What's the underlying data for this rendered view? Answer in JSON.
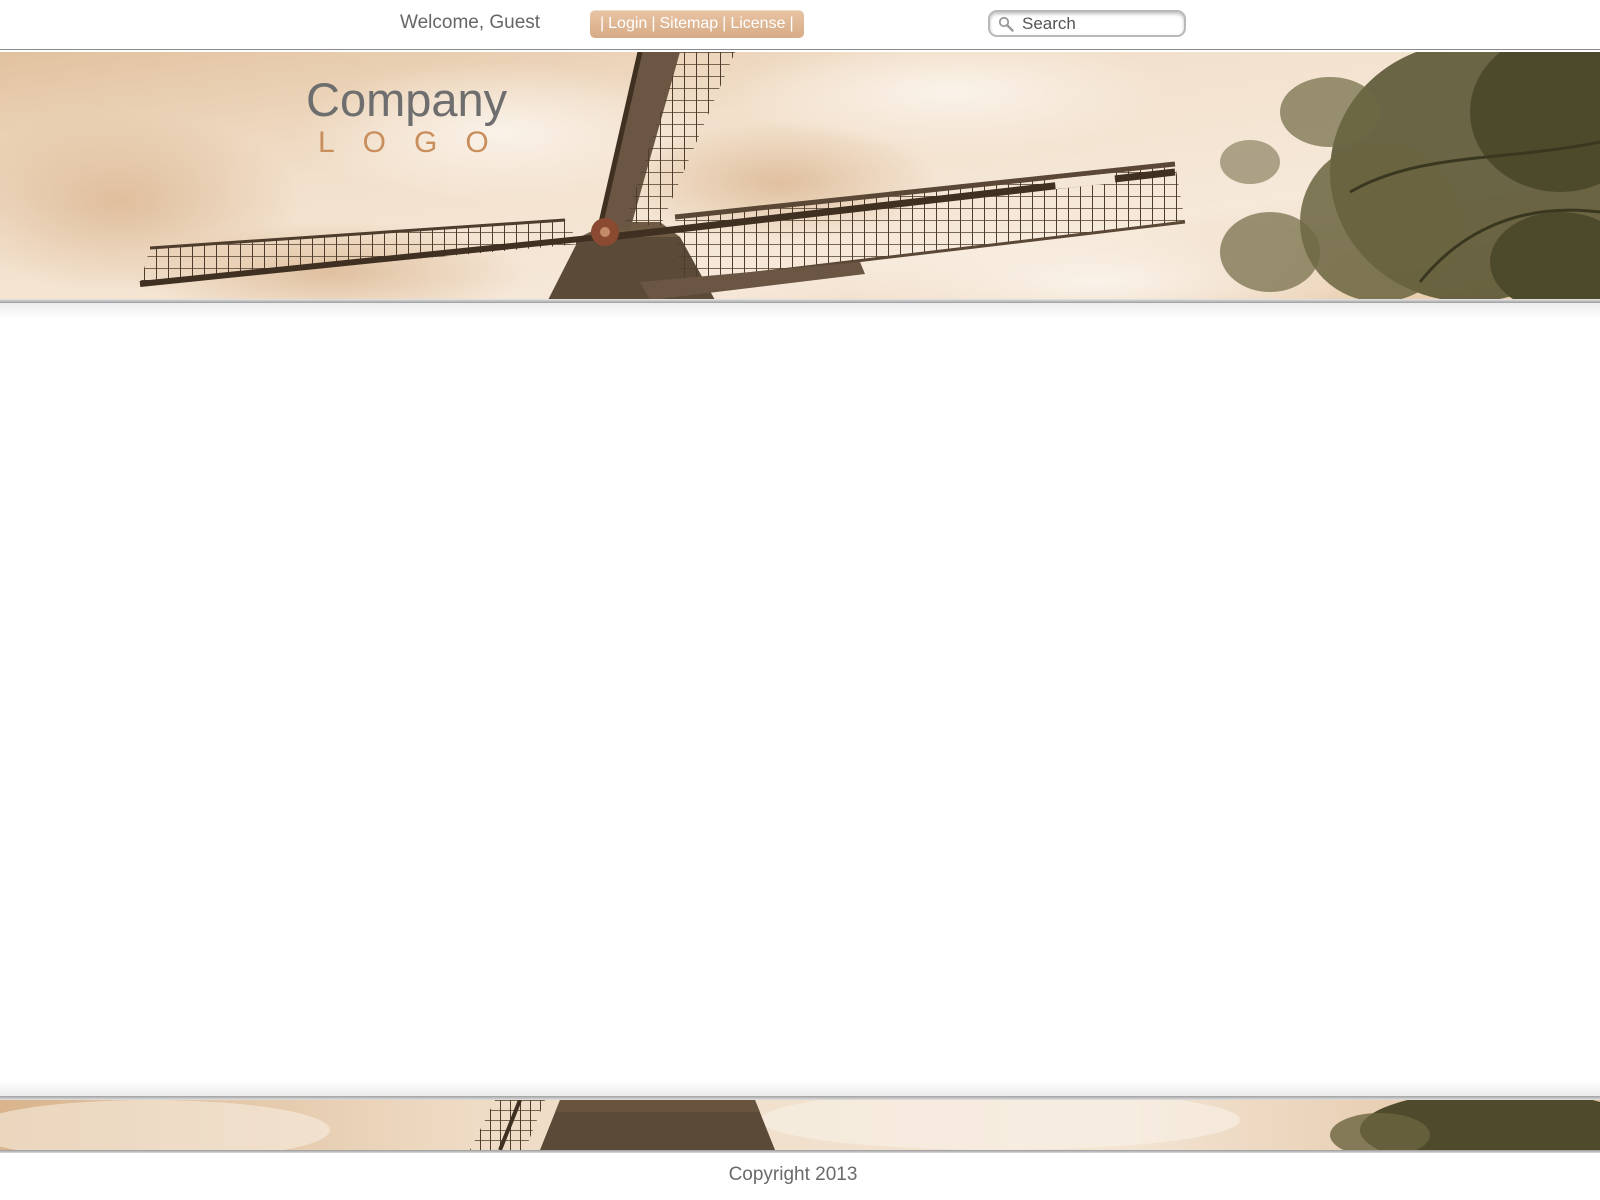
{
  "topbar": {
    "welcome": "Welcome, Guest",
    "nav": {
      "separator": "|",
      "links": [
        {
          "label": "Login"
        },
        {
          "label": "Sitemap"
        },
        {
          "label": "License"
        }
      ]
    },
    "search": {
      "placeholder": "Search",
      "value": "",
      "icon": "search-icon"
    }
  },
  "header": {
    "logo_company": "Company",
    "logo_sub": "LOGO",
    "banner_image": "sepia-windmill-photo"
  },
  "footer": {
    "banner_image": "sepia-windmill-photo-strip",
    "copyright": "Copyright 2013"
  },
  "colors": {
    "nav_pill": "#d9ad88",
    "logo_sub": "#c88e5c",
    "text": "#666666",
    "sepia_sky": "#e9cfb1"
  }
}
